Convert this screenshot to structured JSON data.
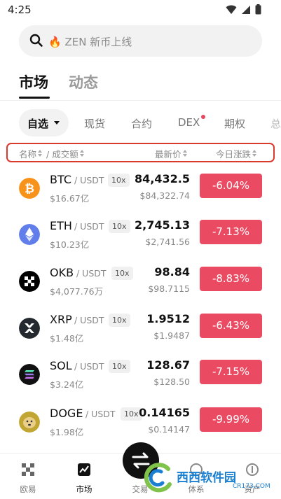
{
  "status": {
    "time": "4:25"
  },
  "search": {
    "placeholder_fire": "🔥",
    "placeholder": "ZEN 新币上线"
  },
  "main_tabs": [
    {
      "label": "市场",
      "active": true
    },
    {
      "label": "动态",
      "active": false
    }
  ],
  "sub_tabs": [
    {
      "label": "自选",
      "active": true
    },
    {
      "label": "现货"
    },
    {
      "label": "合约"
    },
    {
      "label": "DEX",
      "dot": true
    },
    {
      "label": "期权"
    },
    {
      "label": "总"
    }
  ],
  "list_header": {
    "name": "名称",
    "volume": "/ 成交额",
    "price": "最新价",
    "change": "今日涨跌"
  },
  "coins": [
    {
      "symbol": "BTC",
      "pair": "/ USDT",
      "leverage": "10x",
      "volume": "$16.67亿",
      "price": "84,432.5",
      "price_usd": "$84,322.74",
      "change": "-6.04%",
      "icon": "btc-icon",
      "icon_color": "#f7931a"
    },
    {
      "symbol": "ETH",
      "pair": "/ USDT",
      "leverage": "10x",
      "volume": "$10.23亿",
      "price": "2,745.13",
      "price_usd": "$2,741.56",
      "change": "-7.13%",
      "icon": "eth-icon",
      "icon_color": "#627eea"
    },
    {
      "symbol": "OKB",
      "pair": "/ USDT",
      "leverage": "10x",
      "volume": "$4,077.76万",
      "price": "98.84",
      "price_usd": "$98.7115",
      "change": "-8.83%",
      "icon": "okb-icon",
      "icon_color": "#000000"
    },
    {
      "symbol": "XRP",
      "pair": "/ USDT",
      "leverage": "10x",
      "volume": "$1.48亿",
      "price": "1.9512",
      "price_usd": "$1.9487",
      "change": "-6.43%",
      "icon": "xrp-icon",
      "icon_color": "#23292f"
    },
    {
      "symbol": "SOL",
      "pair": "/ USDT",
      "leverage": "10x",
      "volume": "$3.24亿",
      "price": "128.67",
      "price_usd": "$128.50",
      "change": "-7.15%",
      "icon": "sol-icon",
      "icon_color": "#111111"
    },
    {
      "symbol": "DOGE",
      "pair": "/ USDT",
      "leverage": "10x",
      "volume": "$1.98亿",
      "price": "0.14165",
      "price_usd": "$0.14147",
      "change": "-9.99%",
      "icon": "doge-icon",
      "icon_color": "#c2a633"
    }
  ],
  "bottom_nav": [
    {
      "label": "欧易",
      "icon": "okx-logo-icon",
      "active": false
    },
    {
      "label": "市场",
      "icon": "market-chart-icon",
      "active": true
    },
    {
      "label": "交易",
      "icon": "swap-arrows-icon",
      "active": false
    },
    {
      "label": "体系",
      "icon": "explore-icon",
      "active": false
    },
    {
      "label": "资产",
      "icon": "wallet-icon",
      "active": false
    }
  ],
  "watermark": {
    "text": "西西软件园",
    "url": "CR173.COM"
  },
  "colors": {
    "negative": "#ea4b63",
    "highlight_border": "#d93a2c"
  }
}
